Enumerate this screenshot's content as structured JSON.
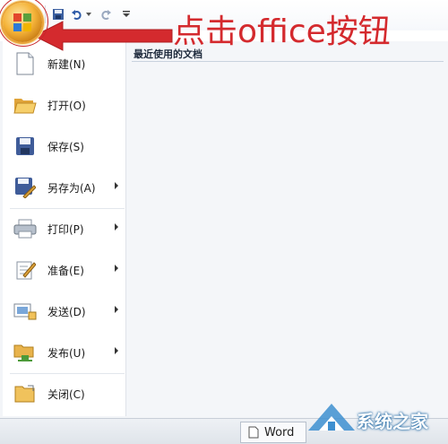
{
  "annotation": {
    "text": "点击office按钮",
    "color": "#d42a2e"
  },
  "menu": {
    "items": [
      {
        "label": "新建(N)",
        "icon": "new-document-icon",
        "submenu": false
      },
      {
        "label": "打开(O)",
        "icon": "open-folder-icon",
        "submenu": false
      },
      {
        "label": "保存(S)",
        "icon": "floppy-disk-icon",
        "submenu": false
      },
      {
        "label": "另存为(A)",
        "icon": "save-as-icon",
        "submenu": true
      },
      {
        "label": "打印(P)",
        "icon": "printer-icon",
        "submenu": true
      },
      {
        "label": "准备(E)",
        "icon": "prepare-icon",
        "submenu": true
      },
      {
        "label": "发送(D)",
        "icon": "send-icon",
        "submenu": true
      },
      {
        "label": "发布(U)",
        "icon": "publish-icon",
        "submenu": true
      },
      {
        "label": "关闭(C)",
        "icon": "close-folder-icon",
        "submenu": false
      }
    ],
    "recent_title": "最近使用的文档"
  },
  "taskbar": {
    "word_label": "Word"
  },
  "watermark": {
    "text": "系统之家"
  }
}
